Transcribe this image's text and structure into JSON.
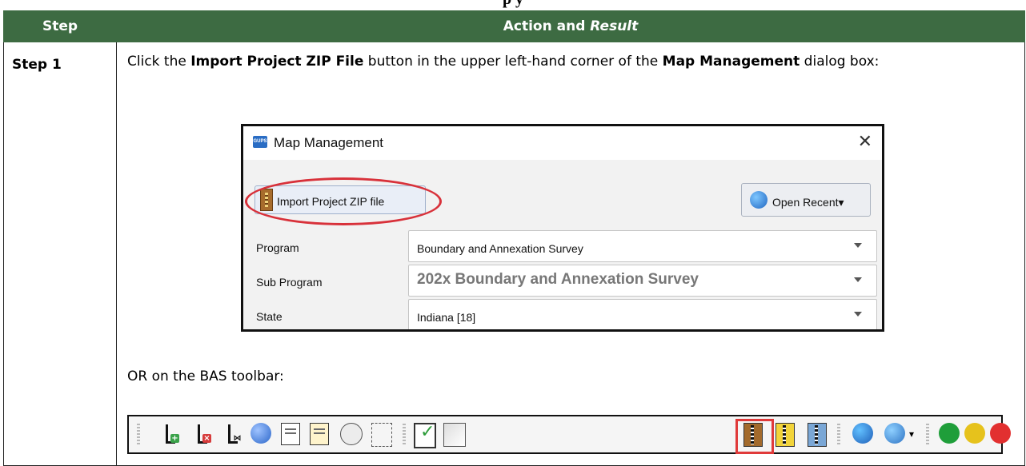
{
  "document": {
    "table_title_clipped": "p                    y"
  },
  "table": {
    "headers": {
      "step": "Step",
      "action": "Action and",
      "result": "Result"
    },
    "rows": [
      {
        "step": "Step 1",
        "text_part1": "Click the ",
        "text_bold1": "Import Project ZIP File",
        "text_part2": " button in the upper left-hand corner of the ",
        "text_bold2": "Map Management",
        "text_part3": " dialog box:",
        "or_text": "OR on the BAS toolbar:"
      }
    ]
  },
  "dialog": {
    "title": "Map Management",
    "app_icon_text": "GUPS",
    "close_glyph": "✕",
    "import_button_label": "Import Project ZIP file",
    "open_recent_label": "Open Recent",
    "open_recent_arrow": "▾",
    "fields": [
      {
        "label": "Program",
        "value": "Boundary and Annexation Survey"
      },
      {
        "label": "Sub Program",
        "value": "202x Boundary and Annexation Survey"
      },
      {
        "label": "State",
        "value": "Indiana [18]"
      }
    ]
  },
  "toolbar": {
    "name": "BAS toolbar",
    "icons": [
      "add-layer-icon",
      "remove-layer-icon",
      "split-icon",
      "label-icon",
      "attribute-doc-icon",
      "table-edit-icon",
      "identify-icon",
      "tree-icon",
      "validate-icon",
      "polygon-icon",
      "import-zip-icon",
      "export-zip-icon",
      "export-blue-zip-icon",
      "globe-icon",
      "add-globe-icon",
      "add-marker-icon",
      "star-marker-icon",
      "remove-marker-icon"
    ],
    "highlighted_icon": "import-zip-icon",
    "colors": {
      "highlight": "#e03a3a",
      "header_green": "#3d6b42",
      "annotation_red": "#d8313a"
    }
  }
}
